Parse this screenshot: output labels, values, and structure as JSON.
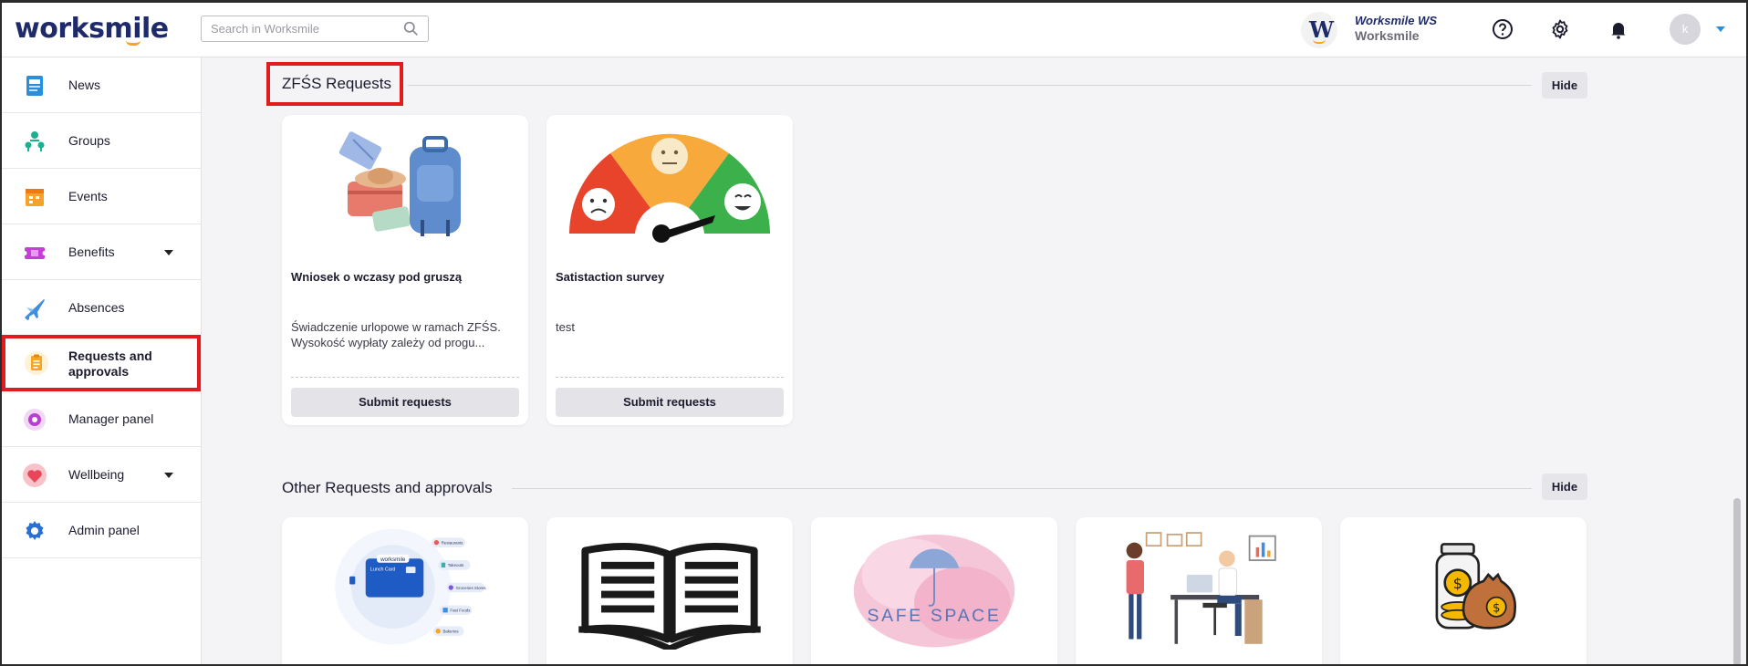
{
  "header": {
    "logo_text": "worksmile",
    "search_placeholder": "Search in Worksmile",
    "company_initial": "W",
    "company_name": "Worksmile WS",
    "company_sub": "Worksmile",
    "user_initial": "k"
  },
  "sidebar": {
    "items": [
      {
        "label": "News",
        "icon": "news-icon"
      },
      {
        "label": "Groups",
        "icon": "groups-icon"
      },
      {
        "label": "Events",
        "icon": "calendar-icon"
      },
      {
        "label": "Benefits",
        "icon": "ticket-icon"
      },
      {
        "label": "Absences",
        "icon": "plane-icon"
      },
      {
        "label": "Requests and approvals",
        "icon": "clipboard-icon"
      },
      {
        "label": "Manager panel",
        "icon": "manager-icon"
      },
      {
        "label": "Wellbeing",
        "icon": "heart-icon"
      },
      {
        "label": "Admin panel",
        "icon": "gear-icon"
      }
    ]
  },
  "sections": {
    "zfss": {
      "title": "ZFŚS Requests",
      "hide_label": "Hide",
      "cards": [
        {
          "title": "Wniosek o wczasy pod gruszą",
          "desc_line1": "Świadczenie urlopowe w ramach ZFŚS.",
          "desc_line2": "Wysokość wypłaty zależy od progu...",
          "button": "Submit requests"
        },
        {
          "title": "Satistaction survey",
          "desc_line1": "test",
          "button": "Submit requests"
        }
      ]
    },
    "other": {
      "title": "Other Requests and approvals",
      "hide_label": "Hide",
      "cards": [
        {
          "image": "lunch-card-illustration",
          "card_label": "worksmile",
          "card_sub": "Lunch Card",
          "bubbles": [
            "Restaurants",
            "Takeouts",
            "Groceries Stores",
            "Fast Foods",
            "Bakeries"
          ]
        },
        {
          "image": "open-book-illustration"
        },
        {
          "image": "safe-space-illustration",
          "text": "SAFE SPACE"
        },
        {
          "image": "office-meeting-illustration"
        },
        {
          "image": "money-jar-illustration"
        }
      ]
    }
  },
  "colors": {
    "brand_navy": "#1f2a6b",
    "brand_orange": "#f5a623",
    "highlight_red": "#e11c1c"
  }
}
